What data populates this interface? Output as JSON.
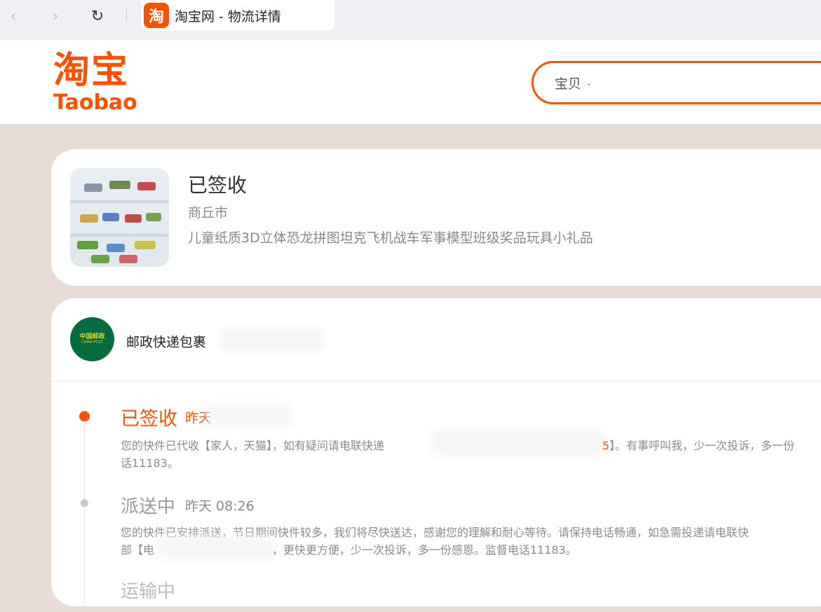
{
  "browser": {
    "back_icon": "chevron-left-icon",
    "forward_icon": "chevron-right-icon",
    "reload_icon": "reload-icon",
    "tab_title": "淘宝网 - 物流详情",
    "favicon_text": "淘"
  },
  "header": {
    "logo_cn": "淘宝",
    "logo_en": "Taobao",
    "search_category": "宝贝",
    "brand_color": "#ff5000"
  },
  "order": {
    "status": "已签收",
    "city": "商丘市",
    "product_name": "儿童纸质3D立体恐龙拼图坦克飞机战车军事模型班级奖品玩具小礼品"
  },
  "logistics": {
    "carrier_logo_cn": "中国邮政",
    "carrier_logo_en": "CHINA POST",
    "carrier_name": "邮政快递包裹",
    "events": [
      {
        "status": "已签收",
        "time": "昨天",
        "desc_line1_start": "您的快件已代收【家人，天猫】，如有疑问请电联快递",
        "desc_line1_highlight": "5",
        "desc_line1_end": "】。有事呼叫我，少一次投诉，多一份",
        "desc_line2": "话11183。"
      },
      {
        "status": "派送中",
        "time": "昨天 08:26",
        "desc_line1": "您的快件已安排派送，节日期间快件较多，我们将尽快送达，感谢您的理解和耐心等待。请保持电话畅通，如急需投递请电联快",
        "desc_line2_start": "部【电",
        "desc_line2_end": "，更快更方便，少一次投诉，多一份感恩。监督电话11183。"
      },
      {
        "status": "运输中"
      }
    ]
  }
}
